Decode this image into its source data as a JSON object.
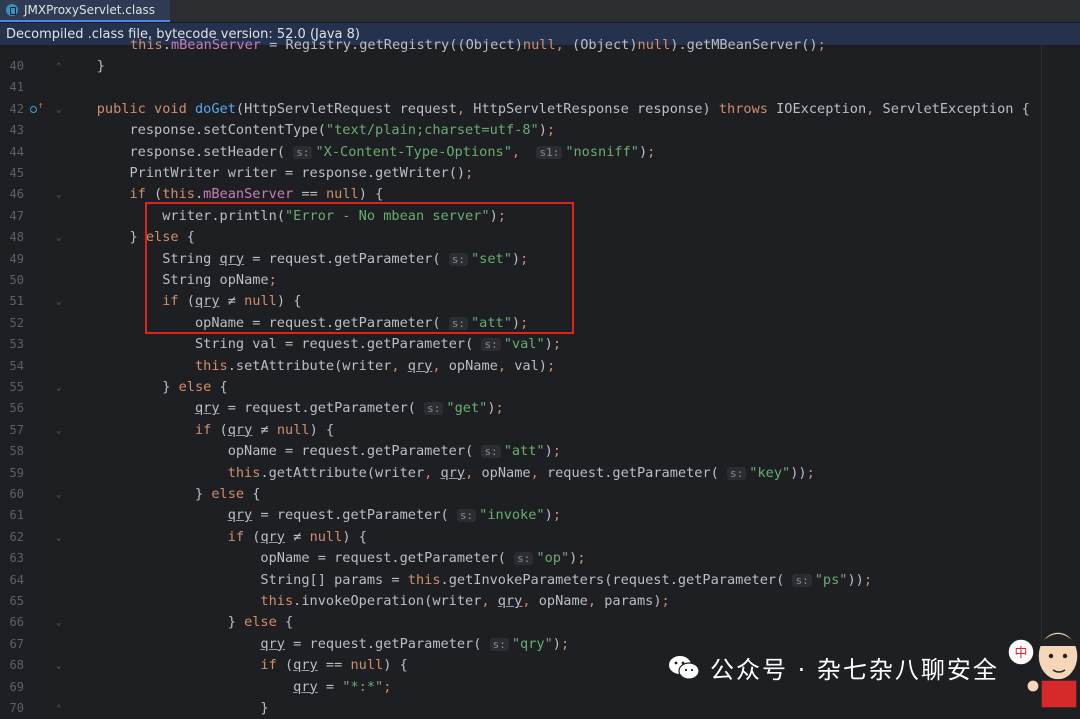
{
  "tab": {
    "title": "JMXProxyServlet.class"
  },
  "banner": {
    "text": "Decompiled .class file, bytecode version: 52.0 (Java 8)"
  },
  "watermark": {
    "text": "公众号 · 杂七杂八聊安全",
    "avatar_badge": "中"
  },
  "colors": {
    "keyword": "#cf8e6d",
    "method": "#56a8f5",
    "string": "#6aab73",
    "field": "#c77dbb",
    "text": "#bcbec4",
    "highlight_box": "#e0221e"
  },
  "code": {
    "partial_top": "this.mBeanServer = Registry.getRegistry((Object)null, (Object)null).getMBeanServer();",
    "lines": [
      {
        "n": "40",
        "t": "    }"
      },
      {
        "n": "41",
        "t": ""
      },
      {
        "n": "42",
        "t": "    public void doGet(HttpServletRequest request, HttpServletResponse response) throws IOException, ServletException {"
      },
      {
        "n": "43",
        "t": "        response.setContentType(\"text/plain;charset=utf-8\");"
      },
      {
        "n": "44",
        "t": "        response.setHeader( s: \"X-Content-Type-Options\",  s1: \"nosniff\");"
      },
      {
        "n": "45",
        "t": "        PrintWriter writer = response.getWriter();"
      },
      {
        "n": "46",
        "t": "        if (this.mBeanServer == null) {"
      },
      {
        "n": "47",
        "t": "            writer.println(\"Error - No mbean server\");"
      },
      {
        "n": "48",
        "t": "        } else {"
      },
      {
        "n": "49",
        "t": "            String qry = request.getParameter( s: \"set\");"
      },
      {
        "n": "50",
        "t": "            String opName;"
      },
      {
        "n": "51",
        "t": "            if (qry ≠ null) {"
      },
      {
        "n": "52",
        "t": "                opName = request.getParameter( s: \"att\");"
      },
      {
        "n": "53",
        "t": "                String val = request.getParameter( s: \"val\");"
      },
      {
        "n": "54",
        "t": "                this.setAttribute(writer, qry, opName, val);"
      },
      {
        "n": "55",
        "t": "            } else {"
      },
      {
        "n": "56",
        "t": "                qry = request.getParameter( s: \"get\");"
      },
      {
        "n": "57",
        "t": "                if (qry ≠ null) {"
      },
      {
        "n": "58",
        "t": "                    opName = request.getParameter( s: \"att\");"
      },
      {
        "n": "59",
        "t": "                    this.getAttribute(writer, qry, opName, request.getParameter( s: \"key\"));"
      },
      {
        "n": "60",
        "t": "                } else {"
      },
      {
        "n": "61",
        "t": "                    qry = request.getParameter( s: \"invoke\");"
      },
      {
        "n": "62",
        "t": "                    if (qry ≠ null) {"
      },
      {
        "n": "63",
        "t": "                        opName = request.getParameter( s: \"op\");"
      },
      {
        "n": "64",
        "t": "                        String[] params = this.getInvokeParameters(request.getParameter( s: \"ps\"));"
      },
      {
        "n": "65",
        "t": "                        this.invokeOperation(writer, qry, opName, params);"
      },
      {
        "n": "66",
        "t": "                    } else {"
      },
      {
        "n": "67",
        "t": "                        qry = request.getParameter( s: \"qry\");"
      },
      {
        "n": "68",
        "t": "                        if (qry == null) {"
      },
      {
        "n": "69",
        "t": "                            qry = \"*:*\";"
      },
      {
        "n": "70",
        "t": "                        }"
      }
    ]
  }
}
